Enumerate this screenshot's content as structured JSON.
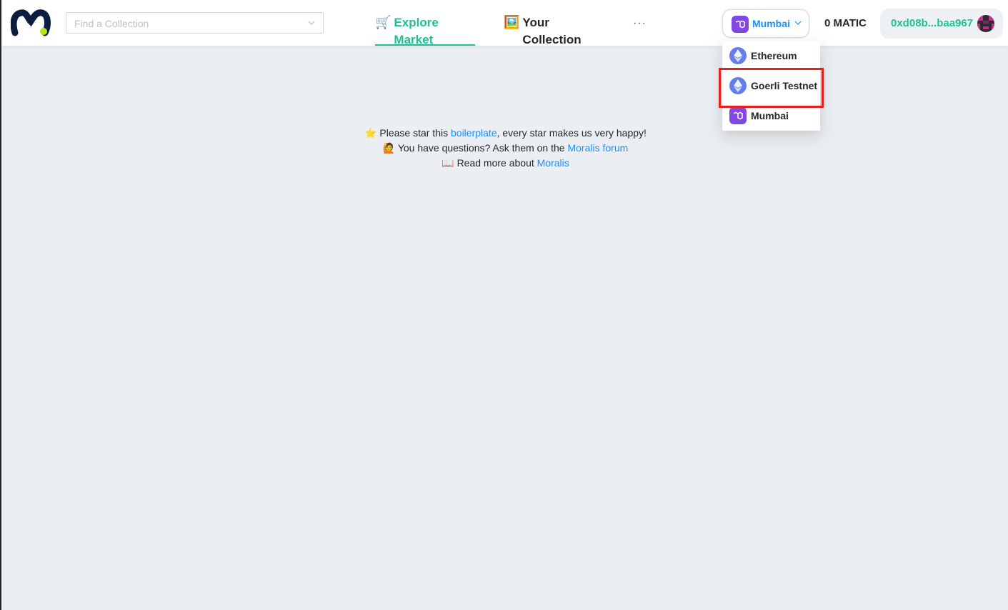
{
  "header": {
    "search": {
      "placeholder": "Find a Collection"
    },
    "nav": {
      "explore": {
        "emoji": "🛒",
        "label": "Explore Market"
      },
      "collection": {
        "emoji": "🖼️",
        "label": "Your Collection"
      },
      "more": "···"
    },
    "chain": {
      "selected": "Mumbai",
      "icon": "polygon-icon"
    },
    "balance": "0 MATIC",
    "account": {
      "address": "0xd08b...baa967"
    }
  },
  "chain_menu": {
    "items": [
      {
        "label": "Ethereum",
        "icon": "ethereum-icon"
      },
      {
        "label": "Goerli Testnet",
        "icon": "ethereum-icon"
      },
      {
        "label": "Mumbai",
        "icon": "polygon-icon"
      }
    ]
  },
  "info": {
    "line1": {
      "emoji": "⭐",
      "prefix": "Please star this ",
      "link": "boilerplate",
      "suffix": ", every star makes us very happy!"
    },
    "line2": {
      "emoji": "🙋",
      "prefix": "You have questions? Ask them on the ",
      "link": "Moralis forum"
    },
    "line3": {
      "emoji": "📖",
      "prefix": "Read more about ",
      "link": "Moralis"
    }
  },
  "colors": {
    "accent": "#21bf96",
    "link": "#1890ff",
    "polygon": "#8247e5",
    "ethereum": "#627eea",
    "highlight": "#e8201c"
  }
}
